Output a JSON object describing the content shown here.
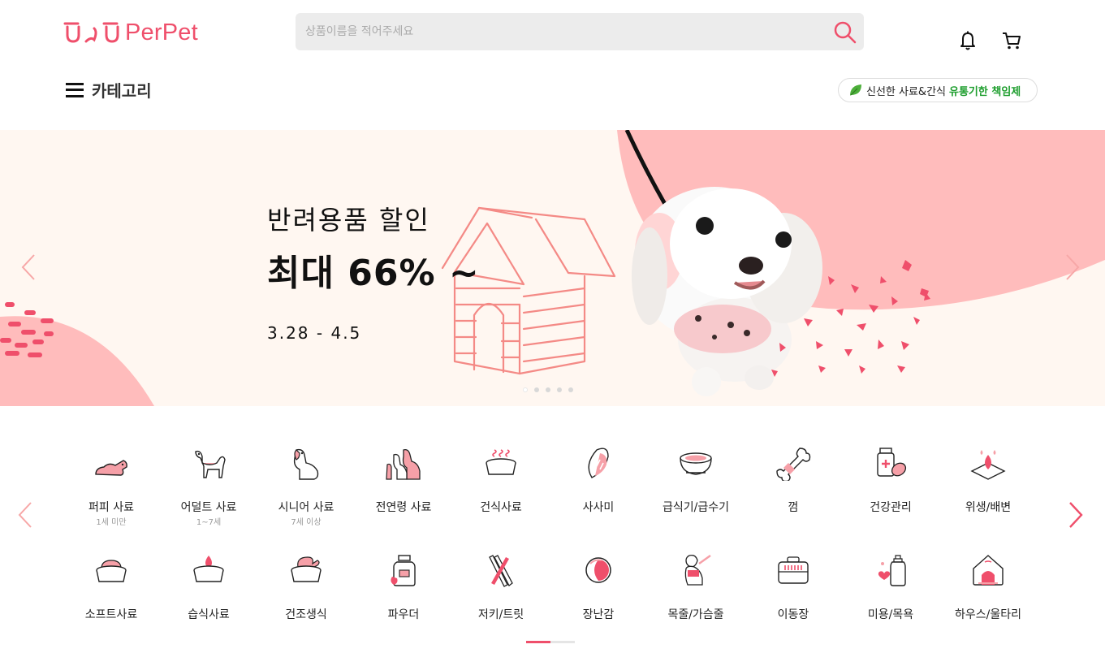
{
  "brand": {
    "name": "PerPet",
    "accent": "#ef4f6b"
  },
  "search": {
    "placeholder": "상품이름을 적어주세요",
    "value": ""
  },
  "nav": {
    "category_label": "카테고리"
  },
  "badge": {
    "text_plain": "신선한 사료&간식",
    "text_highlight": "유통기한 책임제"
  },
  "banner": {
    "line1": "반려용품 할인",
    "line2": "최대 66% ~",
    "date": "3.28  - 4.5",
    "slide_count": 5,
    "active_slide": 1
  },
  "categories": {
    "row1": [
      {
        "label": "퍼피 사료",
        "sub": "1세 미만",
        "icon": "puppy-icon"
      },
      {
        "label": "어덜트 사료",
        "sub": "1~7세",
        "icon": "adult-dog-icon"
      },
      {
        "label": "시니어 사료",
        "sub": "7세 이상",
        "icon": "senior-dog-icon"
      },
      {
        "label": "전연령 사료",
        "sub": "",
        "icon": "all-age-dogs-icon"
      },
      {
        "label": "건식사료",
        "sub": "",
        "icon": "dry-food-bowl-icon"
      },
      {
        "label": "사사미",
        "sub": "",
        "icon": "sasami-icon"
      },
      {
        "label": "급식기/급수기",
        "sub": "",
        "icon": "feeder-bowl-icon"
      },
      {
        "label": "껌",
        "sub": "",
        "icon": "bone-chew-icon"
      },
      {
        "label": "건강관리",
        "sub": "",
        "icon": "health-supplement-icon"
      },
      {
        "label": "위생/배변",
        "sub": "",
        "icon": "pee-pad-icon"
      }
    ],
    "row2": [
      {
        "label": "소프트사료",
        "sub": "",
        "icon": "soft-food-bowl-icon"
      },
      {
        "label": "습식사료",
        "sub": "",
        "icon": "wet-food-bowl-icon"
      },
      {
        "label": "건조생식",
        "sub": "",
        "icon": "dried-raw-food-icon"
      },
      {
        "label": "파우더",
        "sub": "",
        "icon": "powder-jar-icon"
      },
      {
        "label": "저키/트릿",
        "sub": "",
        "icon": "jerky-treat-icon"
      },
      {
        "label": "장난감",
        "sub": "",
        "icon": "toy-ball-icon"
      },
      {
        "label": "목줄/가슴줄",
        "sub": "",
        "icon": "leash-harness-icon"
      },
      {
        "label": "이동장",
        "sub": "",
        "icon": "pet-carrier-icon"
      },
      {
        "label": "미용/목욕",
        "sub": "",
        "icon": "grooming-bottle-icon"
      },
      {
        "label": "하우스/울타리",
        "sub": "",
        "icon": "pet-house-icon"
      }
    ],
    "page_count": 2,
    "active_page": 1
  }
}
